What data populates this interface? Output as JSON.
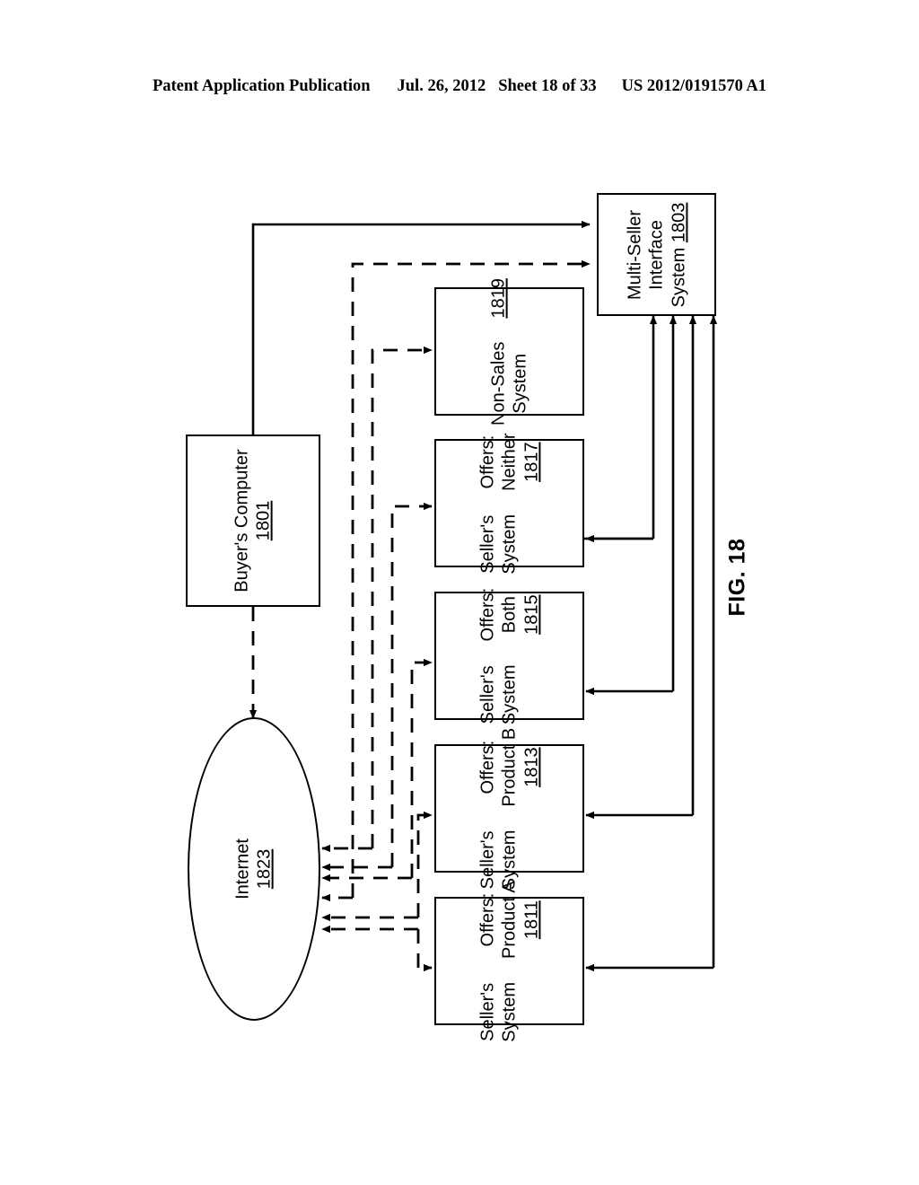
{
  "header": {
    "publication": "Patent Application Publication",
    "date": "Jul. 26, 2012",
    "sheet": "Sheet 18 of 33",
    "docnumber": "US 2012/0191570 A1"
  },
  "figure": {
    "label": "FIG. 18",
    "nodes": [
      {
        "id": "multi-seller-interface-system",
        "shape": "rect",
        "lines": [
          "Multi-Seller",
          "Interface",
          "System"
        ],
        "ref": "1803",
        "ref_inline": true
      },
      {
        "id": "buyers-computer",
        "shape": "rect",
        "lines": [
          "Buyer's Computer"
        ],
        "ref": "1801",
        "ref_inline": false
      },
      {
        "id": "internet",
        "shape": "ellipse",
        "lines": [
          "Internet"
        ],
        "ref": "1823",
        "ref_inline": false
      },
      {
        "id": "non-sales-system",
        "shape": "rect",
        "lines": [
          "Non-Sales",
          "System"
        ],
        "ref": "1819",
        "ref_inline": false
      },
      {
        "id": "sellers-system-offers-neither",
        "shape": "rect",
        "col1": [
          "Seller's",
          "System"
        ],
        "col2": [
          "Offers:",
          "Neither"
        ],
        "ref": "1817"
      },
      {
        "id": "sellers-system-offers-both",
        "shape": "rect",
        "col1": [
          "Seller's",
          "System"
        ],
        "col2": [
          "Offers:",
          "Both"
        ],
        "ref": "1815"
      },
      {
        "id": "sellers-system-offers-product-b",
        "shape": "rect",
        "col1": [
          "Seller's",
          "System"
        ],
        "col2": [
          "Offers:",
          "Product B"
        ],
        "ref": "1813"
      },
      {
        "id": "sellers-system-offers-product-a",
        "shape": "rect",
        "col1": [
          "Seller's",
          "System"
        ],
        "col2": [
          "Offers:",
          "Product A"
        ],
        "ref": "1811"
      }
    ],
    "stroke_color": "#000000"
  }
}
